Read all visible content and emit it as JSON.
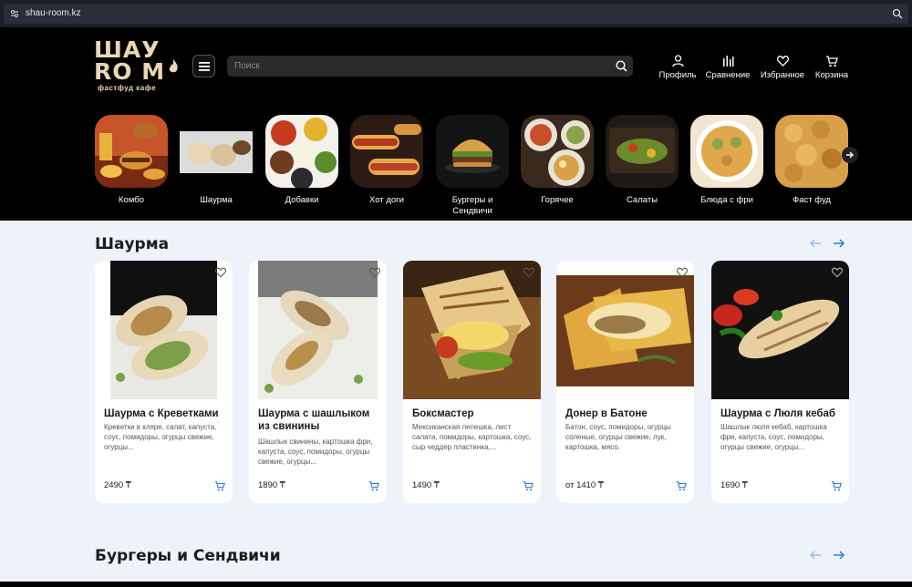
{
  "browser": {
    "url": "shau-room.kz"
  },
  "logo": {
    "line1": "ШАУ",
    "line2": "RO M",
    "tagline": "фастфуд кафе"
  },
  "search": {
    "placeholder": "Поиск"
  },
  "nav": [
    {
      "label": "Профиль",
      "icon": "user-icon"
    },
    {
      "label": "Сравнение",
      "icon": "compare-icon"
    },
    {
      "label": "Избранное",
      "icon": "heart-icon"
    },
    {
      "label": "Корзина",
      "icon": "cart-icon"
    }
  ],
  "categories": [
    {
      "label": "Комбо"
    },
    {
      "label": "Шаурма"
    },
    {
      "label": "Добавки"
    },
    {
      "label": "Хот доги"
    },
    {
      "label": "Бургеры и Сендвичи"
    },
    {
      "label": "Горячее"
    },
    {
      "label": "Салаты"
    },
    {
      "label": "Блюда с фри"
    },
    {
      "label": "Фаст фуд"
    }
  ],
  "sections": [
    {
      "title": "Шаурма",
      "products": [
        {
          "name": "Шаурма с Креветками",
          "desc": "Креветки в кляре, салат, капуста, соус, помидоры, огурцы свежие, огурцы...",
          "price": "2490 ₸"
        },
        {
          "name": "Шаурма с шашлыком из свинины",
          "desc": "Шашлык свинины, картошка фри, капуста, соус, помидоры, огурцы свежие, огурцы...",
          "price": "1890 ₸"
        },
        {
          "name": "Боксмастер",
          "desc": "Мексиканская лепешка, лист салата, помидоры, картошка, соус, сыр чеддер пластинка,...",
          "price": "1490 ₸"
        },
        {
          "name": "Донер в Батоне",
          "desc": "Батон, соус, помидоры, огурцы соленые, огурцы свежие, лук, картошка, мясо.",
          "price": "от 1410 ₸"
        },
        {
          "name": "Шаурма с Люля кебаб",
          "desc": "Шашлык люля кебаб, картошка фри, капуста, соус, помидоры, огурцы свежие, огурцы...",
          "price": "1690 ₸"
        }
      ]
    },
    {
      "title": "Бургеры и Сендвичи"
    }
  ],
  "colors": {
    "accent": "#2f7bd6",
    "header_bg": "#000000",
    "main_bg": "#eef2f9",
    "logo": "#e9d7b3"
  }
}
